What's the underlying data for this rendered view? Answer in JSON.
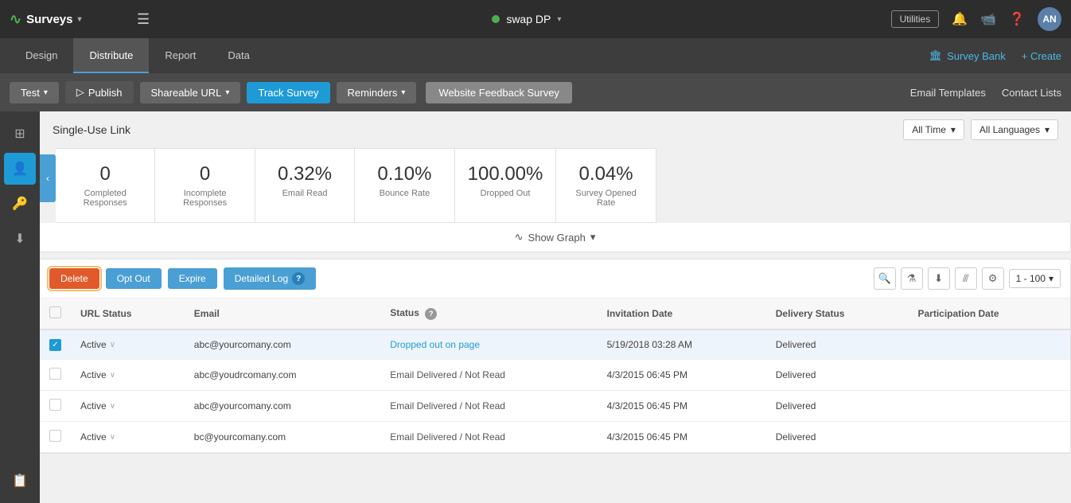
{
  "topbar": {
    "app_name": "Surveys",
    "chevron": "▾",
    "swap_label": "swap DP",
    "utilities_label": "Utilities",
    "avatar_initials": "AN"
  },
  "nav": {
    "tabs": [
      {
        "label": "Design",
        "active": false
      },
      {
        "label": "Distribute",
        "active": true
      },
      {
        "label": "Report",
        "active": false
      },
      {
        "label": "Data",
        "active": false
      }
    ],
    "survey_bank": "Survey Bank",
    "create": "+ Create"
  },
  "toolbar": {
    "test_label": "Test",
    "publish_label": "Publish",
    "shareable_url_label": "Shareable URL",
    "track_survey_label": "Track Survey",
    "reminders_label": "Reminders",
    "survey_name": "Website Feedback Survey",
    "email_templates": "Email Templates",
    "contact_lists": "Contact Lists"
  },
  "page": {
    "title": "Single-Use Link",
    "time_filter": "All Time",
    "language_filter": "All Languages"
  },
  "stats": [
    {
      "value": "0",
      "label": "Completed Responses"
    },
    {
      "value": "0",
      "label": "Incomplete Responses"
    },
    {
      "value": "0.32%",
      "label": "Email Read"
    },
    {
      "value": "0.10%",
      "label": "Bounce Rate"
    },
    {
      "value": "100.00%",
      "label": "Dropped Out"
    },
    {
      "value": "0.04%",
      "label": "Survey Opened Rate"
    }
  ],
  "graph": {
    "show_label": "Show Graph"
  },
  "table_toolbar": {
    "delete_label": "Delete",
    "optout_label": "Opt Out",
    "expire_label": "Expire",
    "detailedlog_label": "Detailed Log",
    "page_range": "1 - 100"
  },
  "table": {
    "columns": [
      "URL Status",
      "Email",
      "Status",
      "Invitation Date",
      "Delivery Status",
      "Participation Date"
    ],
    "rows": [
      {
        "checked": true,
        "url_status": "Active",
        "email": "abc@yourcomany.com",
        "status": "Dropped out on page",
        "status_type": "link",
        "invitation_date": "5/19/2018 03:28 AM",
        "delivery_status": "Delivered",
        "participation_date": ""
      },
      {
        "checked": false,
        "url_status": "Active",
        "email": "abc@youdrcomany.com",
        "status": "Email Delivered / Not Read",
        "status_type": "text",
        "invitation_date": "4/3/2015 06:45 PM",
        "delivery_status": "Delivered",
        "participation_date": ""
      },
      {
        "checked": false,
        "url_status": "Active",
        "email": "abc@yourcomany.com",
        "status": "Email Delivered / Not Read",
        "status_type": "text",
        "invitation_date": "4/3/2015 06:45 PM",
        "delivery_status": "Delivered",
        "participation_date": ""
      },
      {
        "checked": false,
        "url_status": "Active",
        "email": "bc@yourcomany.com",
        "status": "Email Delivered / Not Read",
        "status_type": "text",
        "invitation_date": "4/3/2015 06:45 PM",
        "delivery_status": "Delivered",
        "participation_date": ""
      }
    ]
  },
  "sidebar": {
    "icons": [
      {
        "name": "grid-icon",
        "symbol": "⊞",
        "active": false
      },
      {
        "name": "user-icon",
        "symbol": "👤",
        "active": true
      },
      {
        "name": "key-icon",
        "symbol": "🔑",
        "active": false
      },
      {
        "name": "download-icon",
        "symbol": "⬇",
        "active": false
      }
    ],
    "bottom_icon": {
      "name": "clipboard-icon",
      "symbol": "📋"
    }
  }
}
